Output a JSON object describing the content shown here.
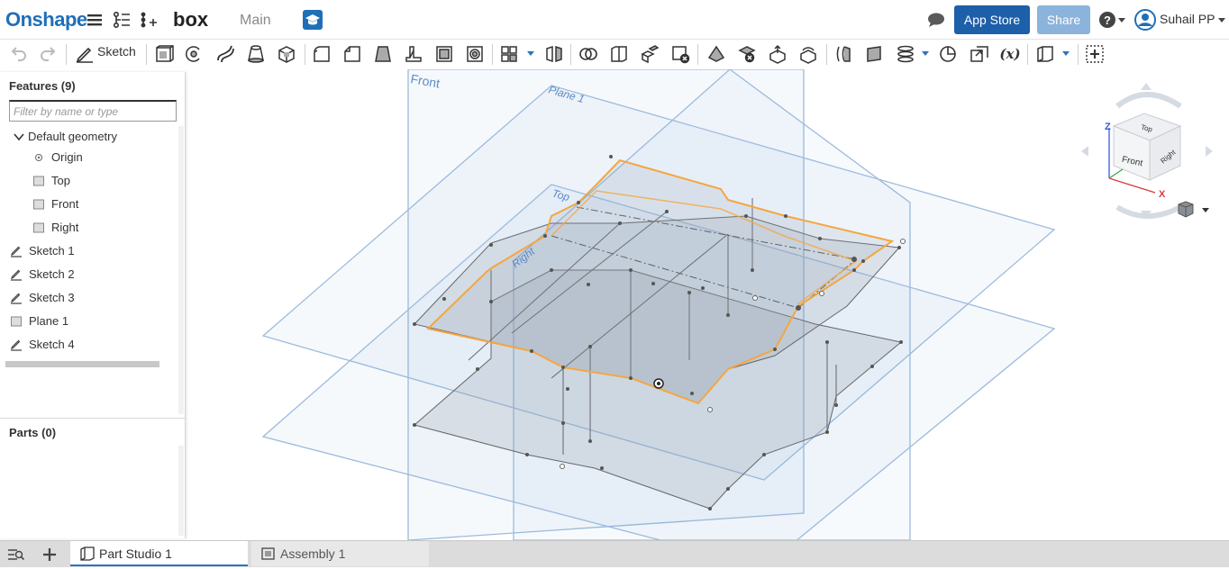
{
  "header": {
    "logo": "Onshape",
    "document_title": "box",
    "workspace": "Main",
    "app_store_label": "App Store",
    "share_label": "Share",
    "help_icon": "help-icon",
    "user_name": "Suhail PP"
  },
  "toolbar": {
    "sketch_label": "Sketch"
  },
  "features_panel": {
    "title": "Features (9)",
    "filter_placeholder": "Filter by name or type",
    "items": [
      {
        "label": "Default geometry",
        "icon": "chevron-down-icon"
      },
      {
        "label": "Origin",
        "icon": "origin-icon"
      },
      {
        "label": "Top",
        "icon": "plane-icon"
      },
      {
        "label": "Front",
        "icon": "plane-icon"
      },
      {
        "label": "Right",
        "icon": "plane-icon"
      },
      {
        "label": "Sketch 1",
        "icon": "sketch-icon"
      },
      {
        "label": "Sketch 2",
        "icon": "sketch-icon"
      },
      {
        "label": "Sketch 3",
        "icon": "sketch-icon"
      },
      {
        "label": "Plane 1",
        "icon": "plane-icon"
      },
      {
        "label": "Sketch 4",
        "icon": "sketch-icon"
      }
    ],
    "parts_title": "Parts (0)"
  },
  "viewport": {
    "plane_labels": [
      "Front",
      "Plane 1",
      "Top",
      "Right"
    ]
  },
  "view_cube": {
    "faces": [
      "Top",
      "Front",
      "Right"
    ],
    "axes": [
      "Z",
      "X"
    ]
  },
  "tabs": [
    {
      "label": "Part Studio 1",
      "active": true
    },
    {
      "label": "Assembly 1",
      "active": false
    }
  ],
  "colors": {
    "brand": "#1f6fb8",
    "app_store": "#1d5fa8",
    "share": "#8cb3dc",
    "selection": "#f5a640",
    "plane": "#6b9bd1"
  }
}
